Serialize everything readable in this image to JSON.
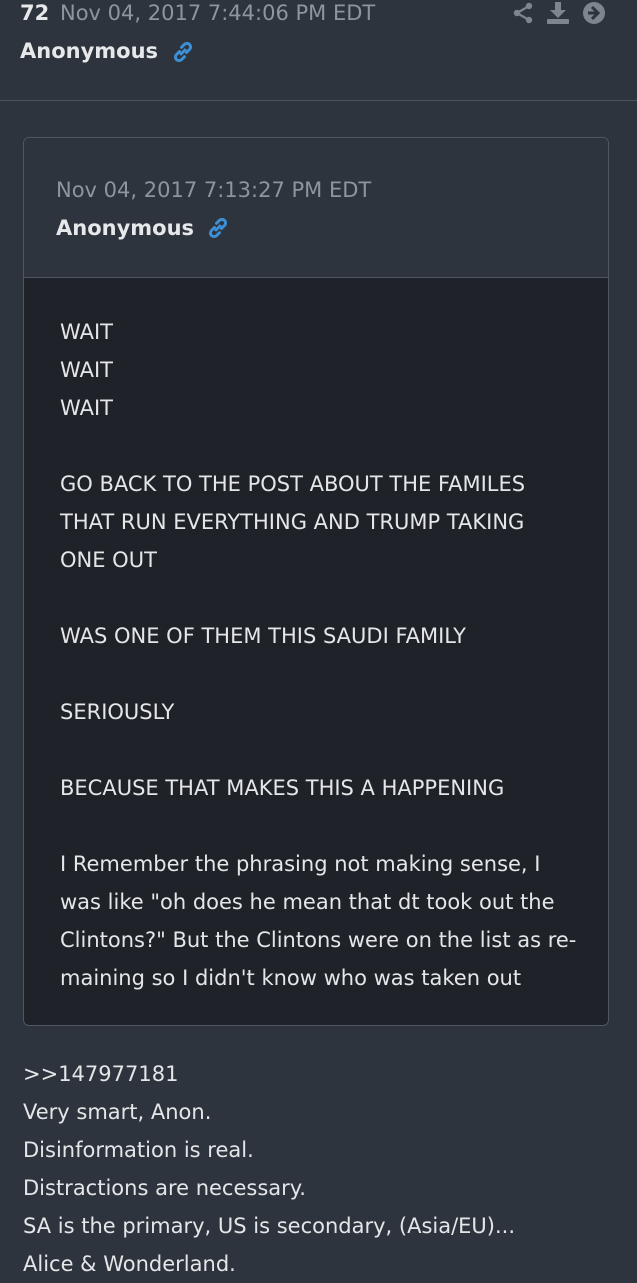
{
  "post": {
    "number": "72",
    "timestamp": "Nov 04, 2017 7:44:06 PM EDT",
    "author": "Anonymous",
    "icons": [
      "share-icon",
      "download-icon",
      "forward-arrow-icon",
      "link-icon"
    ]
  },
  "quoted_post": {
    "timestamp": "Nov 04, 2017 7:13:27 PM EDT",
    "author": "Anonymous",
    "lines": [
      "WAIT",
      "WAIT",
      "WAIT",
      "",
      "GO BACK TO THE POST ABOUT THE FAMILES",
      "THAT RUN EVERYTHING AND TRUMP TAKING",
      "ONE OUT",
      "",
      "WAS ONE OF THEM THIS SAUDI FAMILY",
      "",
      "SERIOUSLY",
      "",
      "BECAUSE THAT MAKES THIS A HAPPENING",
      "",
      "I Remember the phrasing not making sense, I",
      "was like \"oh does he mean that dt took out the",
      "Clintons?\" But the Clintons were on the list as re-",
      "maining so I didn't know who was taken out"
    ]
  },
  "reply": {
    "lines": [
      ">>147977181",
      "Very smart, Anon.",
      "Disinformation is real.",
      "Distractions are necessary.",
      "SA is the primary, US is secondary, (Asia/EU)...",
      "Alice & Wonderland."
    ]
  },
  "colors": {
    "background": "#2e343d",
    "quote_body_bg": "#1f2329",
    "link_icon": "#3d8fd6",
    "text": "#e4e6e8",
    "muted": "#8e959f"
  }
}
